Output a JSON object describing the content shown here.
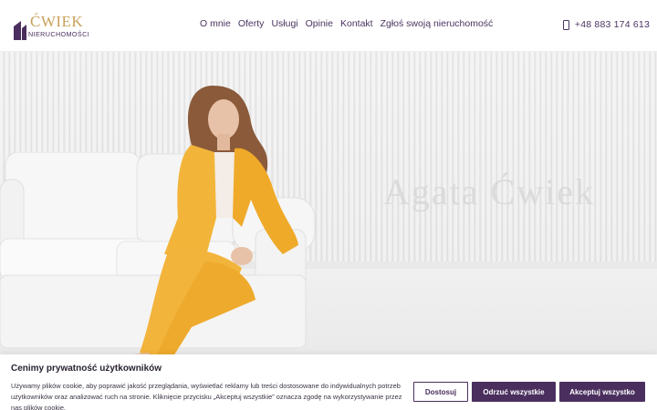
{
  "brand": {
    "name": "ĆWIEK",
    "subtitle": "NIERUCHOMOŚCI",
    "gold_color": "#c9a25a",
    "purple_color": "#4a2f5e"
  },
  "nav": {
    "items": [
      {
        "label": "O mnie"
      },
      {
        "label": "Oferty"
      },
      {
        "label": "Usługi"
      },
      {
        "label": "Opinie"
      },
      {
        "label": "Kontakt"
      },
      {
        "label": "Zgłoś swoją nieruchomość"
      }
    ]
  },
  "contact": {
    "phone": "+48 883 174 613",
    "phone_icon": "smartphone-icon"
  },
  "hero": {
    "watermark": "Agata Ćwiek"
  },
  "cookie": {
    "title": "Cenimy prywatność użytkowników",
    "text": "Używamy plików cookie, aby poprawić jakość przeglądania, wyświetlać reklamy lub treści dostosowane do indywidualnych potrzeb użytkowników oraz analizować ruch na stronie. Kliknięcie przycisku „Akceptuj wszystkie” oznacza zgodę na wykorzystywanie przez nas plików cookie.",
    "customize_label": "Dostosuj",
    "reject_label": "Odrzuć wszystkie",
    "accept_label": "Akceptuj wszystko"
  }
}
